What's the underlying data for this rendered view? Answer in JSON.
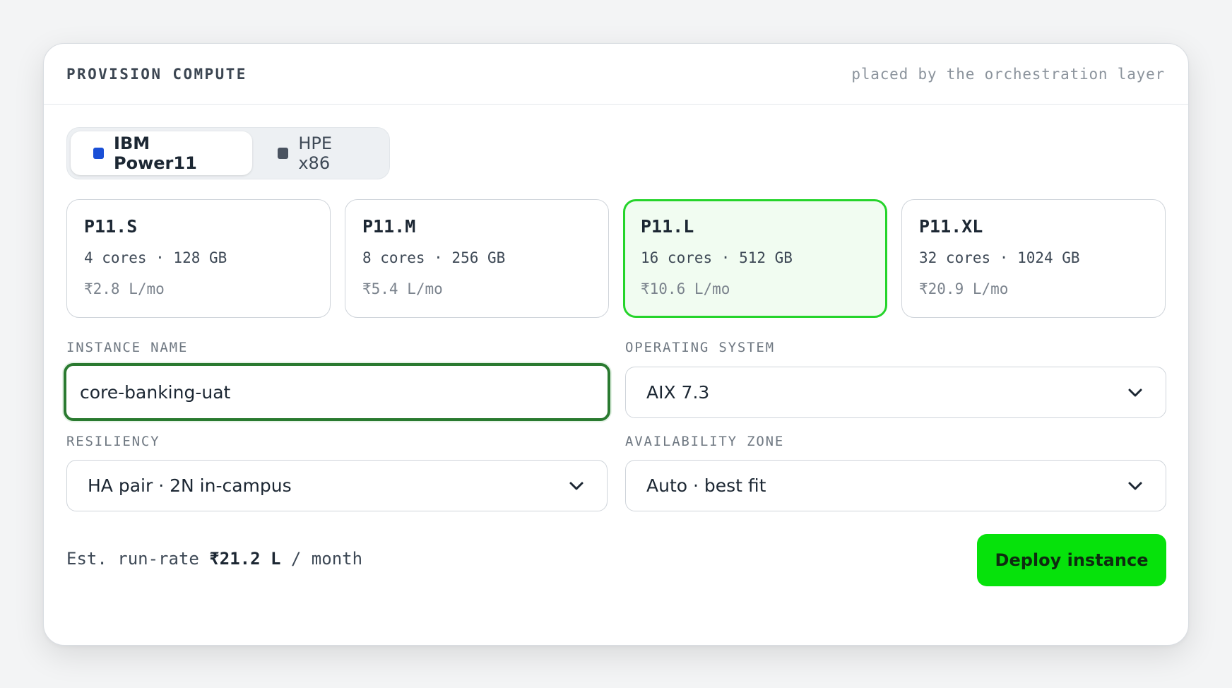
{
  "header": {
    "title": "PROVISION COMPUTE",
    "note": "placed by the orchestration layer"
  },
  "platforms": [
    {
      "label": "IBM Power11",
      "color": "#1a4fd6",
      "active": true
    },
    {
      "label": "HPE x86",
      "color": "#4a5360",
      "active": false
    }
  ],
  "tiers": [
    {
      "name": "P11.S",
      "spec": "4 cores · 128 GB",
      "price": "₹2.8 L/mo"
    },
    {
      "name": "P11.M",
      "spec": "8 cores · 256 GB",
      "price": "₹5.4 L/mo"
    },
    {
      "name": "P11.L",
      "spec": "16 cores · 512 GB",
      "price": "₹10.6 L/mo"
    },
    {
      "name": "P11.XL",
      "spec": "32 cores · 1024 GB",
      "price": "₹20.9 L/mo"
    }
  ],
  "selected_tier": "P11.L",
  "form": {
    "instance_name": {
      "label": "INSTANCE NAME",
      "value": "core-banking-uat"
    },
    "os": {
      "label": "OPERATING SYSTEM",
      "value": "AIX 7.3"
    },
    "resiliency": {
      "label": "RESILIENCY",
      "value": "HA pair · 2N in-campus"
    },
    "zone": {
      "label": "AVAILABILITY ZONE",
      "value": "Auto · best fit"
    }
  },
  "footer": {
    "est_prefix": "Est. run-rate",
    "est_value": "₹21.2 L",
    "est_suffix": "/ month",
    "deploy_label": "Deploy instance"
  },
  "icons": {
    "platform_marker": "square-icon",
    "dropdown": "chevron-down-icon"
  }
}
